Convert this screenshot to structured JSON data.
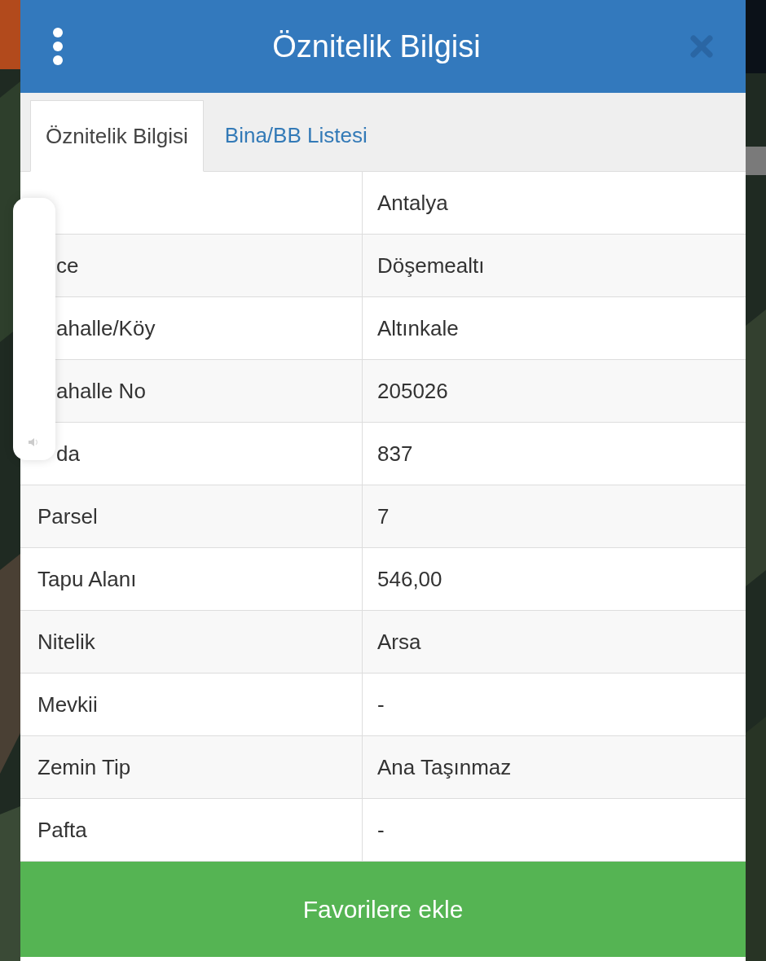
{
  "dialog": {
    "title": "Öznitelik Bilgisi"
  },
  "tabs": [
    {
      "label": "Öznitelik Bilgisi",
      "selected": true
    },
    {
      "label": "Bina/BB Listesi",
      "selected": false
    }
  ],
  "rows": [
    {
      "value": "Antalya",
      "covered": true
    },
    {
      "label": "ce",
      "value": "Döşemealtı",
      "covered": true
    },
    {
      "label": "ahalle/Köy",
      "value": "Altınkale",
      "covered": true
    },
    {
      "label": "ahalle No",
      "value": "205026",
      "covered": true
    },
    {
      "label": "da",
      "value": "837",
      "covered": true
    },
    {
      "label": "Parsel",
      "value": "7",
      "covered": false
    },
    {
      "label": "Tapu Alanı",
      "value": "546,00",
      "covered": false
    },
    {
      "label": "Nitelik",
      "value": "Arsa",
      "covered": false
    },
    {
      "label": "Mevkii",
      "value": "-",
      "covered": false
    },
    {
      "label": "Zemin Tip",
      "value": "Ana Taşınmaz",
      "covered": false
    },
    {
      "label": "Pafta",
      "value": "-",
      "covered": false
    }
  ],
  "action": {
    "label": "Favorilere ekle"
  }
}
